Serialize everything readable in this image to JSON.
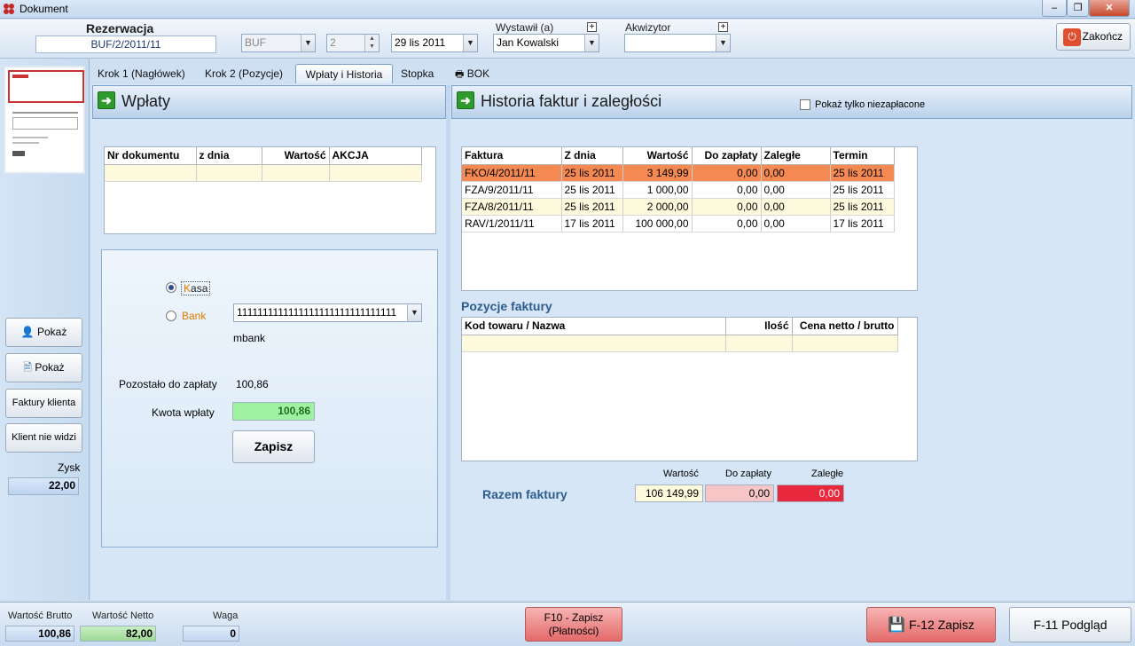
{
  "window": {
    "title": "Dokument",
    "minimize": "–",
    "restore": "❐",
    "close": "✕"
  },
  "header": {
    "title": "Rezerwacja",
    "doc_number": "BUF/2/2011/11",
    "series": "BUF",
    "counter": "2",
    "date": "29  lis  2011",
    "issuer_label": "Wystawił (a)",
    "issuer_value": "Jan Kowalski",
    "acquirer_label": "Akwizytor",
    "acquirer_value": "",
    "close_label": "Zakończ",
    "plus": "+"
  },
  "tabs": [
    {
      "label": "Krok 1 (Nagłówek)"
    },
    {
      "label": "Krok 2 (Pozycje)"
    },
    {
      "label": "Wpłaty i Historia"
    },
    {
      "label": "Stopka"
    },
    {
      "label": "BOK"
    }
  ],
  "sidebar": {
    "buttons": [
      {
        "label": "Pokaż"
      },
      {
        "label": "Pokaż"
      },
      {
        "label": "Faktury klienta"
      },
      {
        "label": "Klient nie widzi"
      }
    ],
    "profit_label": "Zysk",
    "profit_value": "22,00"
  },
  "payments": {
    "title": "Wpłaty",
    "columns": [
      "Nr dokumentu",
      "z dnia",
      "Wartość",
      "AKCJA"
    ],
    "kasa_label": "Kasa",
    "bank_label": "Bank",
    "bank_account": "1111111111111111111111111111111",
    "bank_name": "mbank",
    "remaining_label": "Pozostało do zapłaty",
    "remaining_value": "100,86",
    "amount_label": "Kwota wpłaty",
    "amount_value": "100,86",
    "save_label": "Zapisz"
  },
  "history": {
    "title": "Historia faktur i zaległości",
    "unpaid_only_label": "Pokaż tylko niezapłacone",
    "columns": [
      "Faktura",
      "Z dnia",
      "Wartość",
      "Do zapłaty",
      "Zaległe",
      "Termin"
    ],
    "rows": [
      {
        "faktura": "FKO/4/2011/11",
        "date": "25 lis 2011",
        "value": "3 149,99",
        "due": "0,00",
        "overdue": "0,00",
        "term": "25 lis 2011"
      },
      {
        "faktura": "FZA/9/2011/11",
        "date": "25 lis 2011",
        "value": "1 000,00",
        "due": "0,00",
        "overdue": "0,00",
        "term": "25 lis 2011"
      },
      {
        "faktura": "FZA/8/2011/11",
        "date": "25 lis 2011",
        "value": "2 000,00",
        "due": "0,00",
        "overdue": "0,00",
        "term": "25 lis 2011"
      },
      {
        "faktura": "RAV/1/2011/11",
        "date": "17 lis 2011",
        "value": "100 000,00",
        "due": "0,00",
        "overdue": "0,00",
        "term": "17 lis 2011"
      }
    ],
    "positions_title": "Pozycje faktury",
    "positions_columns": [
      "Kod towaru / Nazwa",
      "Ilość",
      "Cena netto / brutto"
    ],
    "totals_label": "Razem faktury",
    "totals_headers": [
      "Wartość",
      "Do zapłaty",
      "Zaległe"
    ],
    "totals_values": [
      "106 149,99",
      "0,00",
      "0,00"
    ]
  },
  "footer": {
    "brutto_label": "Wartość Brutto",
    "brutto_value": "100,86",
    "netto_label": "Wartość Netto",
    "netto_value": "82,00",
    "weight_label": "Waga",
    "weight_value": "0",
    "f10_line1": "F10 - Zapisz",
    "f10_line2": "(Płatności)",
    "f12_label": "F-12 Zapisz",
    "f11_label": "F-11 Podgląd"
  },
  "colors": {
    "selected_row": "#f48a52",
    "overdue_total": "#e8283c",
    "due_total": "#f6c6c6",
    "amount_field": "#9ff29f",
    "accent_text": "#2e5c8e"
  }
}
